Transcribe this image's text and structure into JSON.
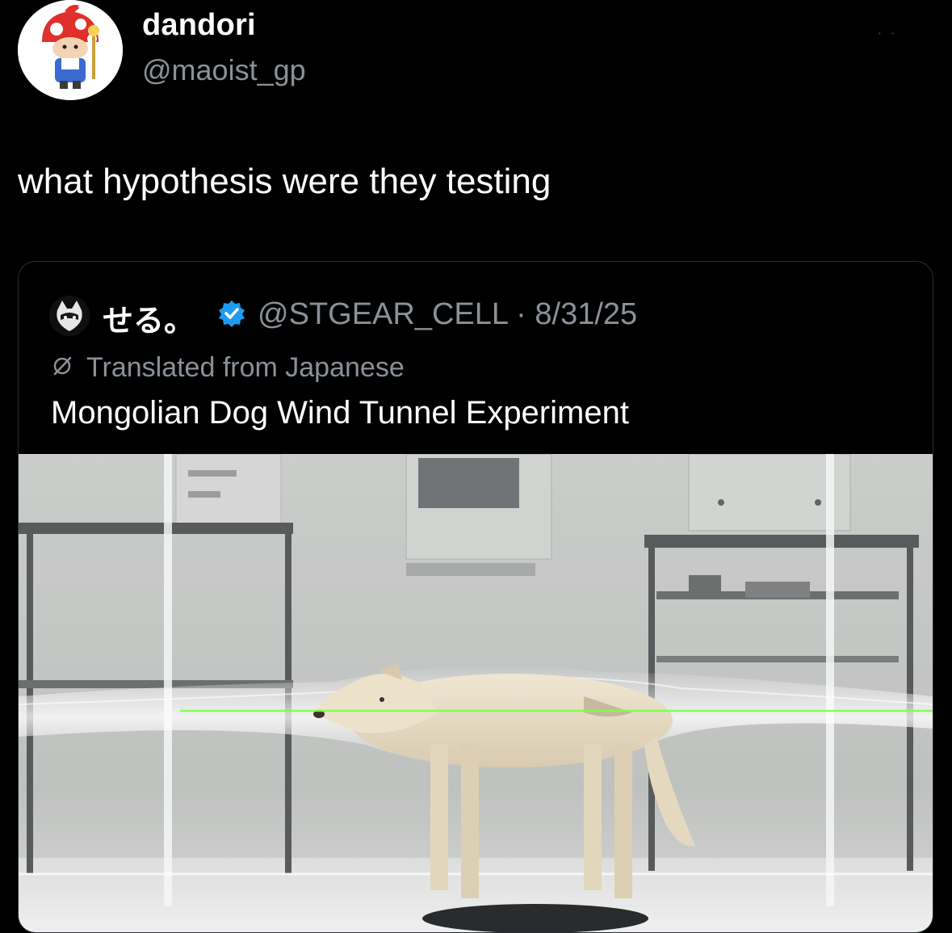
{
  "post": {
    "author": {
      "display_name": "dandori",
      "handle": "@maoist_gp",
      "avatar_icon": "mushroom-character-avatar-icon"
    },
    "more_menu": "· ·",
    "text": "what hypothesis were they testing"
  },
  "quoted_post": {
    "author": {
      "display_name": "せる。",
      "verified": true,
      "verified_color": "#1d9bf0",
      "handle_and_date": "@STGEAR_CELL · 8/31/25",
      "avatar_icon": "cat-avatar-icon"
    },
    "translation_note": "Translated from Japanese",
    "text": "Mongolian Dog Wind Tunnel Experiment",
    "media": {
      "subject": "dog-in-wind-tunnel-image",
      "accent_colors": {
        "laser": "#7dff4a",
        "room": "#c9cbc9",
        "dog": "#e8ddc8"
      }
    }
  }
}
